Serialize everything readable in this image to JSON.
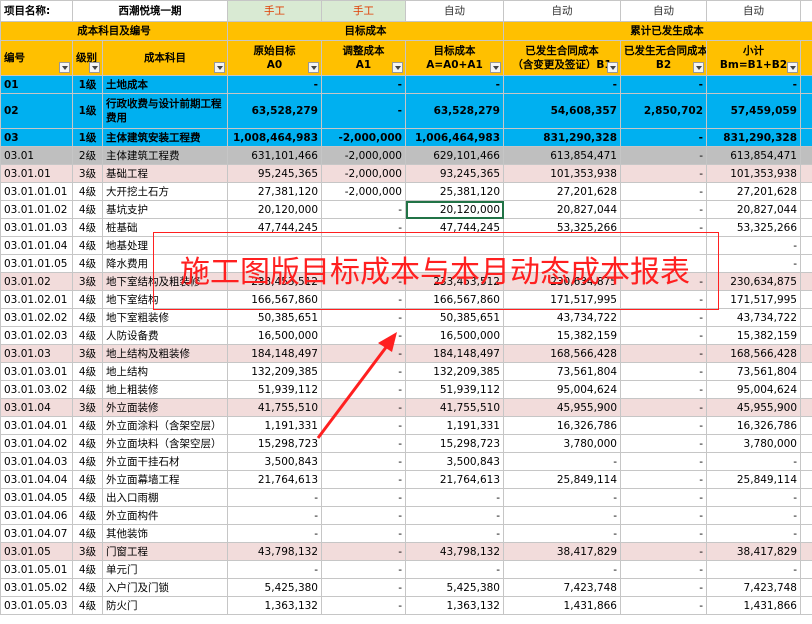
{
  "top": {
    "project_label": "项目名称:",
    "project_name": "西潮悦境一期",
    "mode_manual_1": "手工",
    "mode_manual_2": "手工",
    "mode_auto_1": "自动",
    "mode_auto_2": "自动",
    "mode_auto_3": "自动",
    "mode_auto_4": "自动",
    "big_title": "施工图版目标"
  },
  "groups": {
    "subject": "成本科目及编号",
    "target": "目标成本",
    "accum": "累计已发生成本"
  },
  "headers": {
    "code": "编号",
    "level": "级别",
    "subject": "成本科目",
    "a0_line1": "原始目标",
    "a0_line2": "A0",
    "a1_line1": "调整成本",
    "a1_line2": "A1",
    "a_line1": "目标成本",
    "a_line2": "A=A0+A1",
    "b1_line1": "已发生合同成本",
    "b1_line2": "（含变更及签证）B1",
    "b2_line1": "已发生无合同成本",
    "b2_line2": "B2",
    "bm_line1": "小计",
    "bm_line2": "Bm=B1+B2"
  },
  "rows": [
    {
      "code": "01",
      "level": "1级",
      "name": "土地成本",
      "a0": "-",
      "a1": "-",
      "a": "-",
      "b1": "-",
      "b2": "-",
      "bm": "-"
    },
    {
      "code": "02",
      "level": "1级",
      "name": "行政收费与设计前期工程费用",
      "a0": "63,528,279",
      "a1": "-",
      "a": "63,528,279",
      "b1": "54,608,357",
      "b2": "2,850,702",
      "bm": "57,459,059"
    },
    {
      "code": "03",
      "level": "1级",
      "name": "主体建筑安装工程费",
      "a0": "1,008,464,983",
      "a1": "-2,000,000",
      "a": "1,006,464,983",
      "b1": "831,290,328",
      "b2": "-",
      "bm": "831,290,328"
    },
    {
      "code": "03.01",
      "level": "2级",
      "name": "主体建筑工程费",
      "a0": "631,101,466",
      "a1": "-2,000,000",
      "a": "629,101,466",
      "b1": "613,854,471",
      "b2": "-",
      "bm": "613,854,471"
    },
    {
      "code": "03.01.01",
      "level": "3级",
      "name": "基础工程",
      "a0": "95,245,365",
      "a1": "-2,000,000",
      "a": "93,245,365",
      "b1": "101,353,938",
      "b2": "-",
      "bm": "101,353,938"
    },
    {
      "code": "03.01.01.01",
      "level": "4级",
      "name": "大开挖土石方",
      "a0": "27,381,120",
      "a1": "-2,000,000",
      "a": "25,381,120",
      "b1": "27,201,628",
      "b2": "-",
      "bm": "27,201,628"
    },
    {
      "code": "03.01.01.02",
      "level": "4级",
      "name": "基坑支护",
      "a0": "20,120,000",
      "a1": "-",
      "a": "20,120,000",
      "b1": "20,827,044",
      "b2": "-",
      "bm": "20,827,044"
    },
    {
      "code": "03.01.01.03",
      "level": "4级",
      "name": "桩基础",
      "a0": "47,744,245",
      "a1": "-",
      "a": "47,744,245",
      "b1": "53,325,266",
      "b2": "-",
      "bm": "53,325,266"
    },
    {
      "code": "03.01.01.04",
      "level": "4级",
      "name": "地基处理",
      "a0": "",
      "a1": "",
      "a": "",
      "b1": "",
      "b2": "",
      "bm": "-"
    },
    {
      "code": "03.01.01.05",
      "level": "4级",
      "name": "降水费用",
      "a0": "",
      "a1": "",
      "a": "",
      "b1": "",
      "b2": "",
      "bm": "-"
    },
    {
      "code": "03.01.02",
      "level": "3级",
      "name": "地下室结构及粗装修",
      "a0": "233,453,512",
      "a1": "-",
      "a": "233,453,512",
      "b1": "230,634,875",
      "b2": "-",
      "bm": "230,634,875"
    },
    {
      "code": "03.01.02.01",
      "level": "4级",
      "name": "地下室结构",
      "a0": "166,567,860",
      "a1": "-",
      "a": "166,567,860",
      "b1": "171,517,995",
      "b2": "-",
      "bm": "171,517,995"
    },
    {
      "code": "03.01.02.02",
      "level": "4级",
      "name": "地下室粗装修",
      "a0": "50,385,651",
      "a1": "-",
      "a": "50,385,651",
      "b1": "43,734,722",
      "b2": "-",
      "bm": "43,734,722"
    },
    {
      "code": "03.01.02.03",
      "level": "4级",
      "name": "人防设备费",
      "a0": "16,500,000",
      "a1": "-",
      "a": "16,500,000",
      "b1": "15,382,159",
      "b2": "-",
      "bm": "15,382,159"
    },
    {
      "code": "03.01.03",
      "level": "3级",
      "name": "地上结构及粗装修",
      "a0": "184,148,497",
      "a1": "-",
      "a": "184,148,497",
      "b1": "168,566,428",
      "b2": "-",
      "bm": "168,566,428"
    },
    {
      "code": "03.01.03.01",
      "level": "4级",
      "name": "地上结构",
      "a0": "132,209,385",
      "a1": "-",
      "a": "132,209,385",
      "b1": "73,561,804",
      "b2": "-",
      "bm": "73,561,804"
    },
    {
      "code": "03.01.03.02",
      "level": "4级",
      "name": "地上粗装修",
      "a0": "51,939,112",
      "a1": "-",
      "a": "51,939,112",
      "b1": "95,004,624",
      "b2": "-",
      "bm": "95,004,624"
    },
    {
      "code": "03.01.04",
      "level": "3级",
      "name": "外立面装修",
      "a0": "41,755,510",
      "a1": "-",
      "a": "41,755,510",
      "b1": "45,955,900",
      "b2": "-",
      "bm": "45,955,900"
    },
    {
      "code": "03.01.04.01",
      "level": "4级",
      "name": "外立面涂料（含架空层）",
      "a0": "1,191,331",
      "a1": "-",
      "a": "1,191,331",
      "b1": "16,326,786",
      "b2": "-",
      "bm": "16,326,786"
    },
    {
      "code": "03.01.04.02",
      "level": "4级",
      "name": "外立面块料（含架空层）",
      "a0": "15,298,723",
      "a1": "-",
      "a": "15,298,723",
      "b1": "3,780,000",
      "b2": "-",
      "bm": "3,780,000"
    },
    {
      "code": "03.01.04.03",
      "level": "4级",
      "name": "外立面干挂石材",
      "a0": "3,500,843",
      "a1": "-",
      "a": "3,500,843",
      "b1": "-",
      "b2": "-",
      "bm": "-"
    },
    {
      "code": "03.01.04.04",
      "level": "4级",
      "name": "外立面幕墙工程",
      "a0": "21,764,613",
      "a1": "-",
      "a": "21,764,613",
      "b1": "25,849,114",
      "b2": "-",
      "bm": "25,849,114"
    },
    {
      "code": "03.01.04.05",
      "level": "4级",
      "name": "出入口雨棚",
      "a0": "-",
      "a1": "-",
      "a": "-",
      "b1": "-",
      "b2": "-",
      "bm": "-"
    },
    {
      "code": "03.01.04.06",
      "level": "4级",
      "name": "外立面构件",
      "a0": "-",
      "a1": "-",
      "a": "-",
      "b1": "-",
      "b2": "-",
      "bm": "-"
    },
    {
      "code": "03.01.04.07",
      "level": "4级",
      "name": "其他装饰",
      "a0": "-",
      "a1": "-",
      "a": "-",
      "b1": "-",
      "b2": "-",
      "bm": "-"
    },
    {
      "code": "03.01.05",
      "level": "3级",
      "name": "门窗工程",
      "a0": "43,798,132",
      "a1": "-",
      "a": "43,798,132",
      "b1": "38,417,829",
      "b2": "-",
      "bm": "38,417,829"
    },
    {
      "code": "03.01.05.01",
      "level": "4级",
      "name": "单元门",
      "a0": "-",
      "a1": "-",
      "a": "-",
      "b1": "-",
      "b2": "-",
      "bm": "-"
    },
    {
      "code": "03.01.05.02",
      "level": "4级",
      "name": "入户门及门锁",
      "a0": "5,425,380",
      "a1": "-",
      "a": "5,425,380",
      "b1": "7,423,748",
      "b2": "-",
      "bm": "7,423,748"
    },
    {
      "code": "03.01.05.03",
      "level": "4级",
      "name": "防火门",
      "a0": "1,363,132",
      "a1": "-",
      "a": "1,363,132",
      "b1": "1,431,866",
      "b2": "-",
      "bm": "1,431,866"
    }
  ],
  "overlay_title": "施工图版目标成本与本月动态成本报表",
  "colors": {
    "header_yellow": "#ffc000",
    "level1_blue": "#00b0f0",
    "level2_gray": "#bfbfbf",
    "level3_pink": "#f2dcdb",
    "overlay_red": "#ff2020",
    "manual_green": "#d9ead3"
  }
}
